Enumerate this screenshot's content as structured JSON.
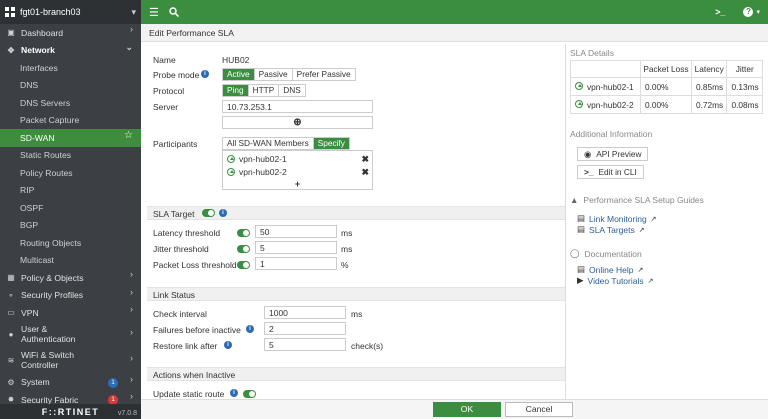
{
  "device": {
    "name": "fgt01-branch03"
  },
  "sidebar": {
    "items": [
      {
        "label": "Dashboard"
      },
      {
        "label": "Network"
      },
      {
        "label": "Interfaces"
      },
      {
        "label": "DNS"
      },
      {
        "label": "DNS Servers"
      },
      {
        "label": "Packet Capture"
      },
      {
        "label": "SD-WAN"
      },
      {
        "label": "Static Routes"
      },
      {
        "label": "Policy Routes"
      },
      {
        "label": "RIP"
      },
      {
        "label": "OSPF"
      },
      {
        "label": "BGP"
      },
      {
        "label": "Routing Objects"
      },
      {
        "label": "Multicast"
      },
      {
        "label": "Policy & Objects"
      },
      {
        "label": "Security Profiles"
      },
      {
        "label": "VPN"
      },
      {
        "label": "User &\nAuthentication"
      },
      {
        "label": "WiFi & Switch\nController"
      },
      {
        "label": "System",
        "badge": "1"
      },
      {
        "label": "Security Fabric",
        "badge": "1"
      }
    ],
    "brand": "F::RTINET",
    "version": "v7.0.8"
  },
  "page": {
    "title": "Edit Performance SLA"
  },
  "form": {
    "name_label": "Name",
    "name_value": "HUB02",
    "probe_label": "Probe mode",
    "probe_options": [
      "Active",
      "Passive",
      "Prefer Passive"
    ],
    "protocol_label": "Protocol",
    "protocol_options": [
      "Ping",
      "HTTP",
      "DNS"
    ],
    "server_label": "Server",
    "server_value": "10.73.253.1",
    "participants_label": "Participants",
    "participants_options": [
      "All SD-WAN Members",
      "Specify"
    ],
    "participants": [
      "vpn-hub02-1",
      "vpn-hub02-2"
    ],
    "sla_target_label": "SLA Target",
    "latency_label": "Latency threshold",
    "latency_value": "50",
    "latency_unit": "ms",
    "jitter_label": "Jitter threshold",
    "jitter_value": "5",
    "jitter_unit": "ms",
    "loss_label": "Packet Loss threshold",
    "loss_value": "1",
    "loss_unit": "%",
    "link_status_label": "Link Status",
    "check_label": "Check interval",
    "check_value": "1000",
    "check_unit": "ms",
    "fail_label": "Failures before inactive",
    "fail_value": "2",
    "restore_label": "Restore link after",
    "restore_value": "5",
    "restore_unit": "check(s)",
    "actions_label": "Actions when Inactive",
    "update_route_label": "Update static route"
  },
  "right": {
    "sla_details_label": "SLA Details",
    "table": {
      "headers": [
        "",
        "Packet Loss",
        "Latency",
        "Jitter"
      ],
      "rows": [
        [
          "vpn-hub02-1",
          "0.00%",
          "0.85ms",
          "0.13ms"
        ],
        [
          "vpn-hub02-2",
          "0.00%",
          "0.72ms",
          "0.08ms"
        ]
      ]
    },
    "additional_label": "Additional Information",
    "api_preview": "API Preview",
    "edit_cli": "Edit in CLI",
    "guides_label": "Performance SLA Setup Guides",
    "link_monitoring": "Link Monitoring",
    "sla_targets": "SLA Targets",
    "documentation_label": "Documentation",
    "online_help": "Online Help",
    "video_tutorials": "Video Tutorials"
  },
  "footer": {
    "ok": "OK",
    "cancel": "Cancel"
  },
  "colors": {
    "accent": "#3b8e40",
    "sidebar": "#3c4044",
    "link": "#2b5e99",
    "badge_blue": "#2d6bb5",
    "badge_red": "#d63b3b"
  }
}
